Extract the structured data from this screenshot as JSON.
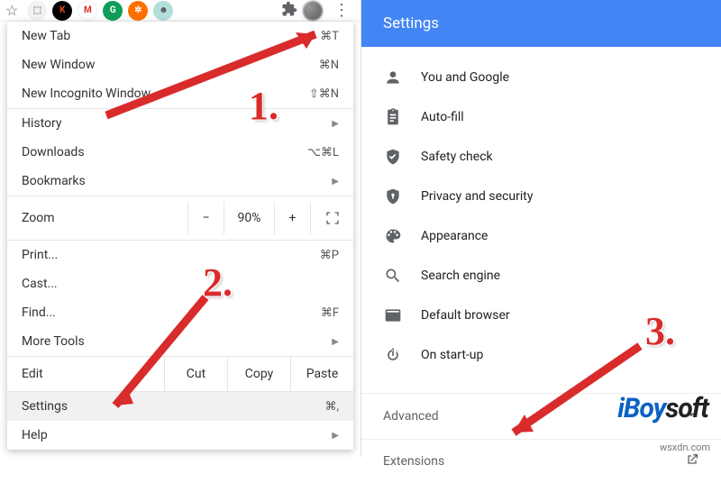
{
  "annotations": {
    "step1": "1.",
    "step2": "2.",
    "step3": "3."
  },
  "toolbar": {
    "ext_icons": [
      {
        "bg": "#f2f2f2",
        "fg": "#888",
        "txt": ""
      },
      {
        "bg": "#000",
        "fg": "#e64a19",
        "txt": "K"
      },
      {
        "bg": "#fff",
        "fg": "#d93025",
        "txt": "M"
      },
      {
        "bg": "#0f9d58",
        "fg": "#fff",
        "txt": "G"
      },
      {
        "bg": "#ff6f00",
        "fg": "#fff",
        "txt": "✽"
      },
      {
        "bg": "#b2dfdb",
        "fg": "#555",
        "txt": "☺"
      }
    ]
  },
  "menu": {
    "new_tab": "New Tab",
    "new_tab_sc": "⌘T",
    "new_window": "New Window",
    "new_window_sc": "⌘N",
    "incognito": "New Incognito Window",
    "incognito_sc": "⇧⌘N",
    "history": "History",
    "downloads": "Downloads",
    "downloads_sc": "⌥⌘L",
    "bookmarks": "Bookmarks",
    "zoom": "Zoom",
    "zoom_minus": "−",
    "zoom_pct": "90%",
    "zoom_plus": "+",
    "print": "Print...",
    "print_sc": "⌘P",
    "cast": "Cast...",
    "find": "Find...",
    "find_sc": "⌘F",
    "more_tools": "More Tools",
    "edit": "Edit",
    "cut": "Cut",
    "copy": "Copy",
    "paste": "Paste",
    "settings": "Settings",
    "settings_sc": "⌘,",
    "help": "Help"
  },
  "settings": {
    "title": "Settings",
    "items": [
      {
        "label": "You and Google"
      },
      {
        "label": "Auto-fill"
      },
      {
        "label": "Safety check"
      },
      {
        "label": "Privacy and security"
      },
      {
        "label": "Appearance"
      },
      {
        "label": "Search engine"
      },
      {
        "label": "Default browser"
      },
      {
        "label": "On start-up"
      }
    ],
    "advanced": "Advanced",
    "extensions": "Extensions"
  },
  "watermark": {
    "left": "iBoy",
    "right": "soft",
    "source": "wsxdn.com"
  }
}
